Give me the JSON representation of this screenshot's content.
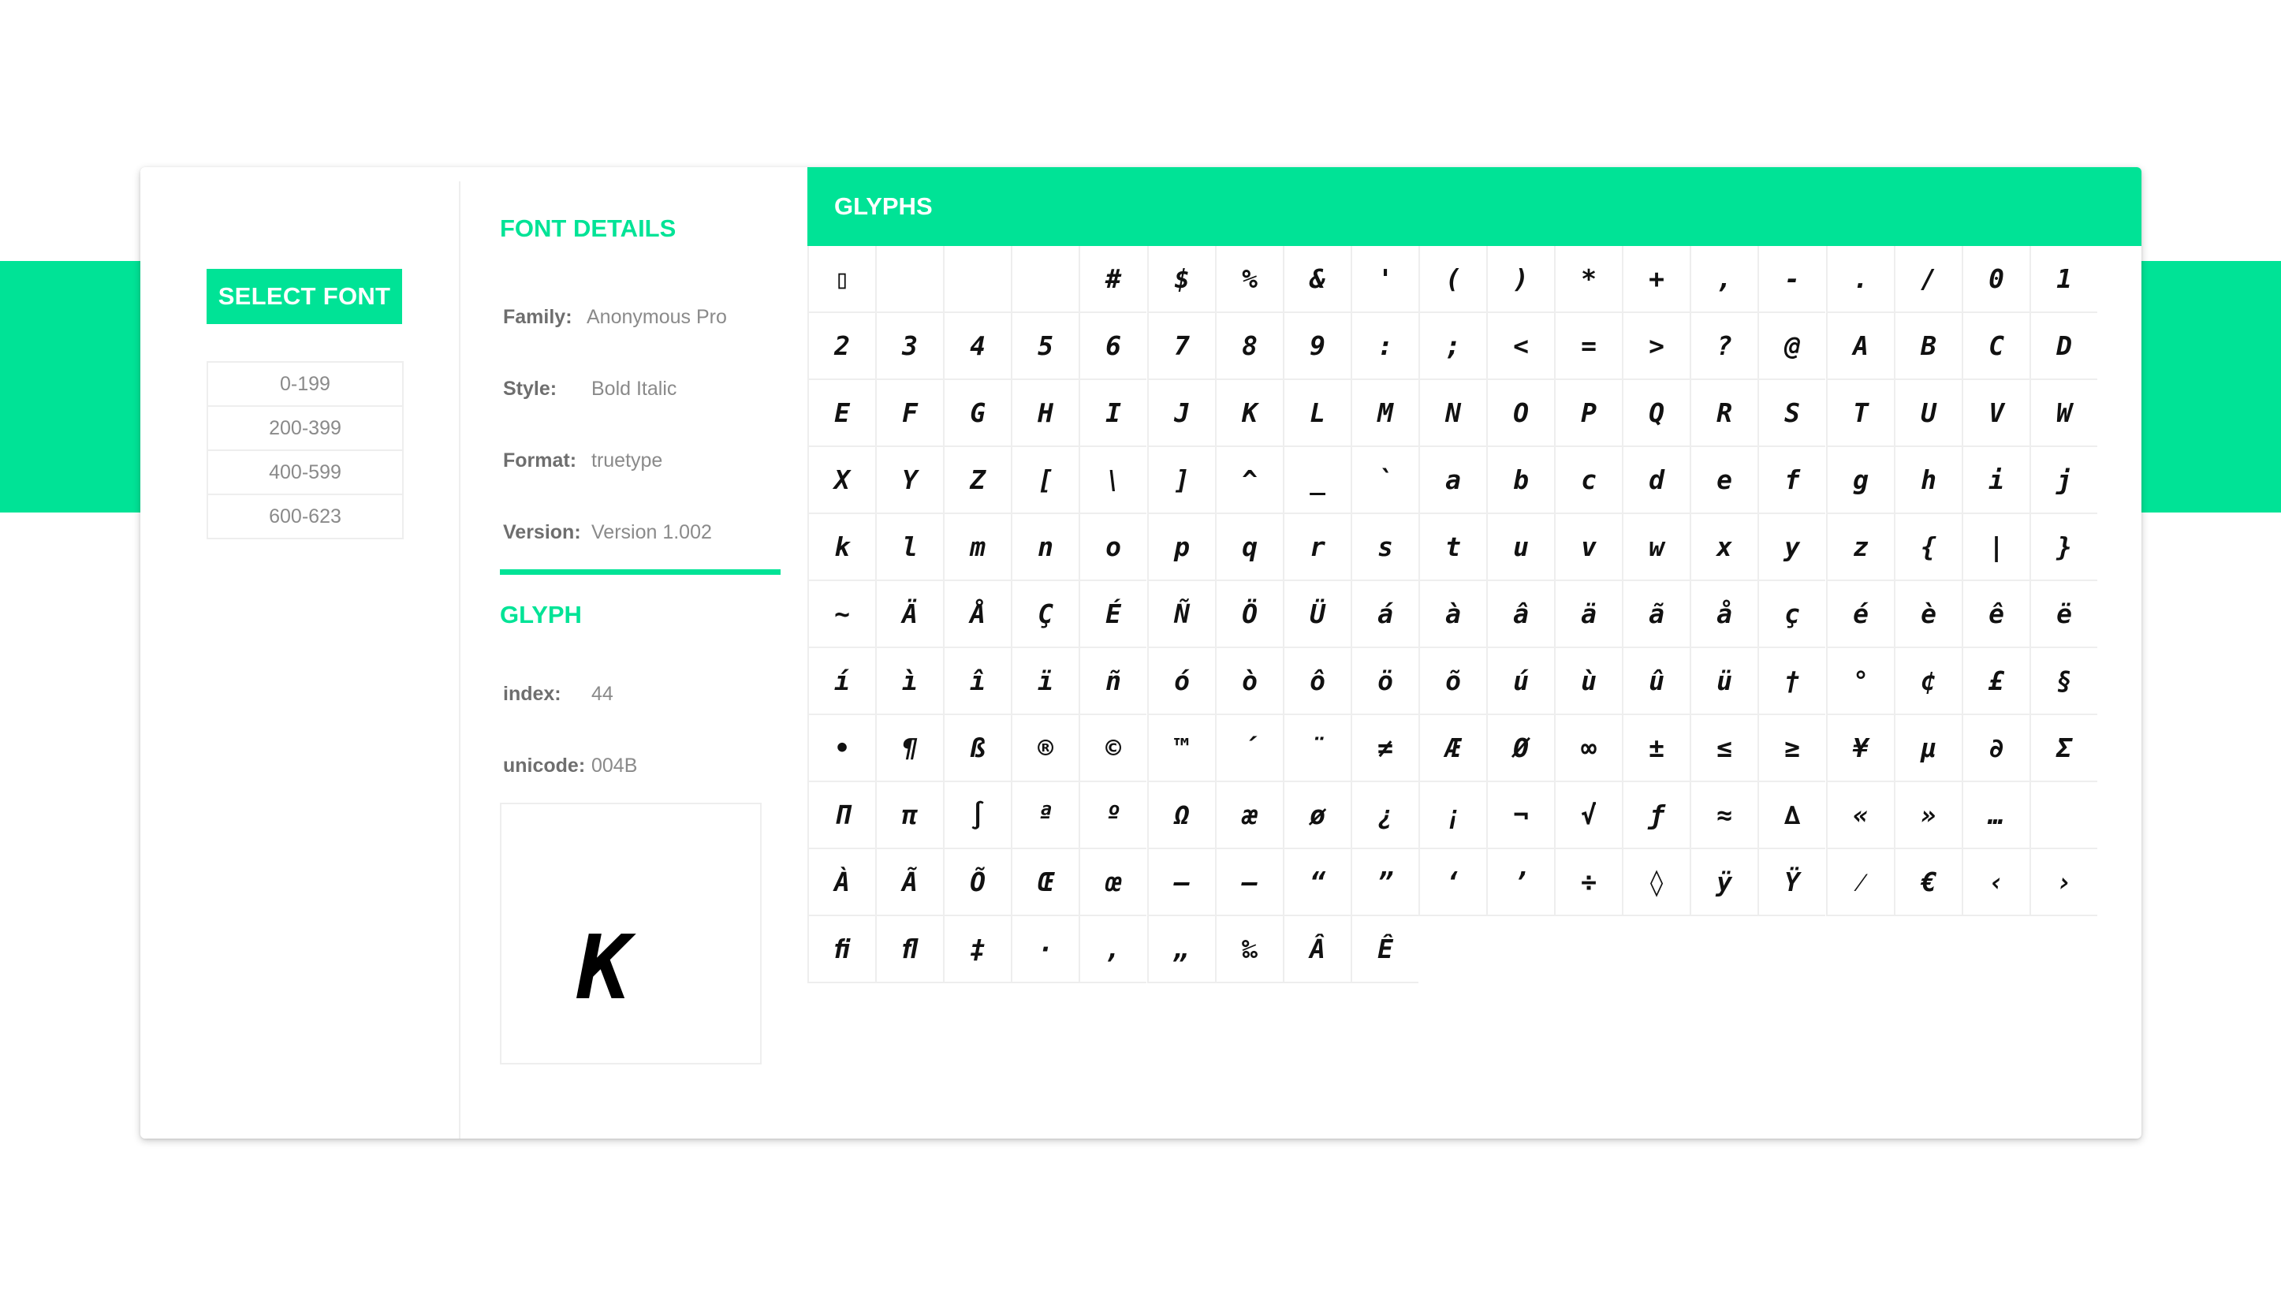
{
  "select_font": {
    "label": "SELECT FONT"
  },
  "ranges": [
    "0-199",
    "200-399",
    "400-599",
    "600-623"
  ],
  "font_details": {
    "title": "FONT DETAILS",
    "family_label": "Family:",
    "family": "Anonymous Pro",
    "style_label": "Style:",
    "style": "Bold Italic",
    "format_label": "Format:",
    "format": "truetype",
    "version_label": "Version:",
    "version": "Version 1.002"
  },
  "glyph": {
    "title": "GLYPH",
    "index_label": "index:",
    "index": "44",
    "unicode_label": "unicode:",
    "unicode": "004B",
    "preview_char": "K"
  },
  "glyphs": {
    "title": "GLYPHS",
    "rows": [
      [
        "▯",
        "",
        "",
        "",
        "#",
        "$",
        "%",
        "&",
        "'",
        "(",
        ")",
        "*",
        "+",
        ",",
        "-",
        ".",
        "/",
        "0",
        "1"
      ],
      [
        "2",
        "3",
        "4",
        "5",
        "6",
        "7",
        "8",
        "9",
        ":",
        ";",
        "<",
        "=",
        ">",
        "?",
        "@",
        "A",
        "B",
        "C",
        "D"
      ],
      [
        "E",
        "F",
        "G",
        "H",
        "I",
        "J",
        "K",
        "L",
        "M",
        "N",
        "O",
        "P",
        "Q",
        "R",
        "S",
        "T",
        "U",
        "V",
        "W"
      ],
      [
        "X",
        "Y",
        "Z",
        "[",
        "\\",
        "]",
        "^",
        "_",
        "`",
        "a",
        "b",
        "c",
        "d",
        "e",
        "f",
        "g",
        "h",
        "i",
        "j"
      ],
      [
        "k",
        "l",
        "m",
        "n",
        "o",
        "p",
        "q",
        "r",
        "s",
        "t",
        "u",
        "v",
        "w",
        "x",
        "y",
        "z",
        "{",
        "|",
        "}"
      ],
      [
        "~",
        "Ä",
        "Å",
        "Ç",
        "É",
        "Ñ",
        "Ö",
        "Ü",
        "á",
        "à",
        "â",
        "ä",
        "ã",
        "å",
        "ç",
        "é",
        "è",
        "ê",
        "ë"
      ],
      [
        "í",
        "ì",
        "î",
        "ï",
        "ñ",
        "ó",
        "ò",
        "ô",
        "ö",
        "õ",
        "ú",
        "ù",
        "û",
        "ü",
        "†",
        "°",
        "¢",
        "£",
        "§"
      ],
      [
        "•",
        "¶",
        "ß",
        "®",
        "©",
        "™",
        "´",
        "¨",
        "≠",
        "Æ",
        "Ø",
        "∞",
        "±",
        "≤",
        "≥",
        "¥",
        "µ",
        "∂",
        "Σ"
      ],
      [
        "Π",
        "π",
        "∫",
        "ª",
        "º",
        "Ω",
        "æ",
        "ø",
        "¿",
        "¡",
        "¬",
        "√",
        "ƒ",
        "≈",
        "∆",
        "«",
        "»",
        "…",
        ""
      ],
      [
        "À",
        "Ã",
        "Õ",
        "Œ",
        "œ",
        "–",
        "—",
        "“",
        "”",
        "‘",
        "’",
        "÷",
        "◊",
        "ÿ",
        "Ÿ",
        "⁄",
        "€",
        "‹",
        "›"
      ],
      [
        "ﬁ",
        "ﬂ",
        "‡",
        "·",
        "‚",
        "„",
        "‰",
        "Â",
        "Ê"
      ]
    ]
  },
  "colors": {
    "accent": "#00e396",
    "border": "#eeeeee",
    "muted_text": "#8a8a8a"
  }
}
